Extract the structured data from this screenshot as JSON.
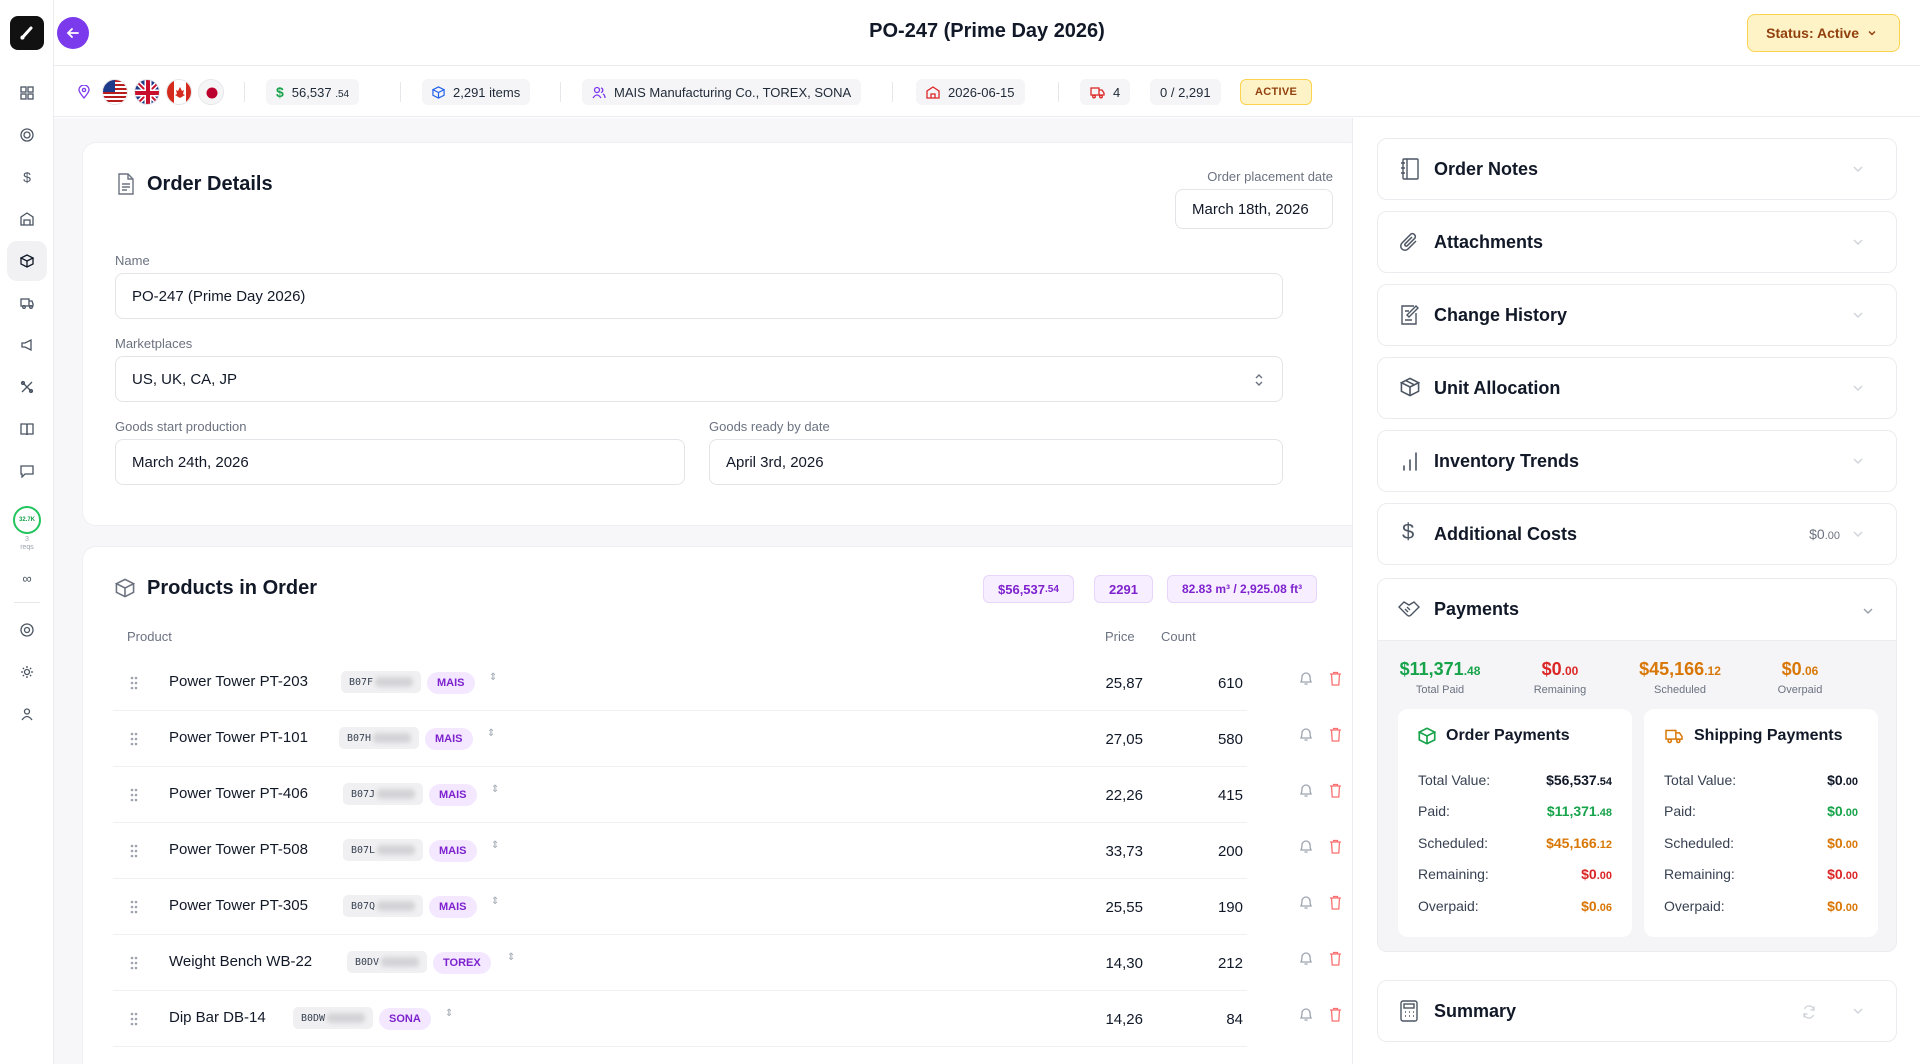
{
  "header": {
    "title": "PO-247 (Prime Day 2026)",
    "status_button": "Status: Active"
  },
  "strip": {
    "amount_main": "56,537",
    "amount_cents": ".54",
    "items": "2,291 items",
    "suppliers": "MAIS Manufacturing Co., TOREX, SONA",
    "date": "2026-06-15",
    "shipments": "4",
    "received": "0 / 2,291",
    "status_badge": "ACTIVE"
  },
  "rail": {
    "ring_value": "32.7K",
    "reqs_count": "3",
    "reqs_label": "reqs",
    "infinity": "∞"
  },
  "order_details": {
    "title": "Order Details",
    "placement_label": "Order placement date",
    "placement_value": "March 18th, 2026",
    "name_label": "Name",
    "name_value": "PO-247 (Prime Day 2026)",
    "marketplaces_label": "Marketplaces",
    "marketplaces_value": "US, UK, CA, JP",
    "start_label": "Goods start production",
    "start_value": "March 24th, 2026",
    "ready_label": "Goods ready by date",
    "ready_value": "April 3rd, 2026"
  },
  "products": {
    "title": "Products in Order",
    "total_main": "$56,537",
    "total_cents": ".54",
    "units": "2291",
    "volume": "82.83 m³ / 2,925.08 ft³",
    "col_product": "Product",
    "col_price": "Price",
    "col_count": "Count",
    "rows": [
      {
        "name": "Power Tower PT-203",
        "sku": "B07F",
        "brand": "MAIS",
        "price": "25,87",
        "count": "610"
      },
      {
        "name": "Power Tower PT-101",
        "sku": "B07H",
        "brand": "MAIS",
        "price": "27,05",
        "count": "580"
      },
      {
        "name": "Power Tower PT-406",
        "sku": "B07J",
        "brand": "MAIS",
        "price": "22,26",
        "count": "415"
      },
      {
        "name": "Power Tower PT-508",
        "sku": "B07L",
        "brand": "MAIS",
        "price": "33,73",
        "count": "200"
      },
      {
        "name": "Power Tower PT-305",
        "sku": "B07Q",
        "brand": "MAIS",
        "price": "25,55",
        "count": "190"
      },
      {
        "name": "Weight Bench WB-22",
        "sku": "B0DV",
        "brand": "TOREX",
        "price": "14,30",
        "count": "212"
      },
      {
        "name": "Dip Bar DB-14",
        "sku": "B0DW",
        "brand": "SONA",
        "price": "14,26",
        "count": "84"
      }
    ]
  },
  "right": {
    "order_notes": "Order Notes",
    "attachments": "Attachments",
    "change_history": "Change History",
    "unit_allocation": "Unit Allocation",
    "inventory_trends": "Inventory Trends",
    "additional_costs": "Additional Costs",
    "additional_costs_main": "$0",
    "additional_costs_cents": ".00",
    "payments": "Payments",
    "summary": "Summary"
  },
  "payments": {
    "total_paid_main": "$11,371",
    "total_paid_cents": ".48",
    "total_paid_label": "Total Paid",
    "remaining_main": "$0",
    "remaining_cents": ".00",
    "remaining_label": "Remaining",
    "scheduled_main": "$45,166",
    "scheduled_cents": ".12",
    "scheduled_label": "Scheduled",
    "overpaid_main": "$0",
    "overpaid_cents": ".06",
    "overpaid_label": "Overpaid",
    "order": {
      "title": "Order Payments",
      "total_label": "Total Value:",
      "total_main": "$56,537",
      "total_cents": ".54",
      "paid_label": "Paid:",
      "paid_main": "$11,371",
      "paid_cents": ".48",
      "scheduled_label": "Scheduled:",
      "scheduled_main": "$45,166",
      "scheduled_cents": ".12",
      "remaining_label": "Remaining:",
      "remaining_main": "$0",
      "remaining_cents": ".00",
      "overpaid_label": "Overpaid:",
      "overpaid_main": "$0",
      "overpaid_cents": ".06"
    },
    "shipping": {
      "title": "Shipping Payments",
      "total_label": "Total Value:",
      "total_main": "$0",
      "total_cents": ".00",
      "paid_label": "Paid:",
      "paid_main": "$0",
      "paid_cents": ".00",
      "scheduled_label": "Scheduled:",
      "scheduled_main": "$0",
      "scheduled_cents": ".00",
      "remaining_label": "Remaining:",
      "remaining_main": "$0",
      "remaining_cents": ".00",
      "overpaid_label": "Overpaid:",
      "overpaid_main": "$0",
      "overpaid_cents": ".00"
    }
  },
  "colors": {
    "accent": "#7c3aed",
    "active_bg": "#fef3c7",
    "green": "#16a34a",
    "red": "#dc2626",
    "orange": "#d97706"
  },
  "icons": [
    "app-logo-icon",
    "back-arrow-icon",
    "grid-icon",
    "target-icon",
    "dollar-icon",
    "warehouse-icon",
    "box-icon",
    "truck-icon",
    "megaphone-icon",
    "tools-icon",
    "book-icon",
    "chat-icon",
    "support-icon",
    "sun-icon",
    "user-icon",
    "location-pin-icon",
    "cube-icon",
    "users-icon",
    "factory-icon",
    "document-icon",
    "notebook-icon",
    "paperclip-icon",
    "edit-icon",
    "chevron-down-icon",
    "bar-chart-icon",
    "handshake-icon",
    "calculator-icon",
    "refresh-icon",
    "drag-handle-icon",
    "sort-icon",
    "bell-icon",
    "trash-icon"
  ]
}
